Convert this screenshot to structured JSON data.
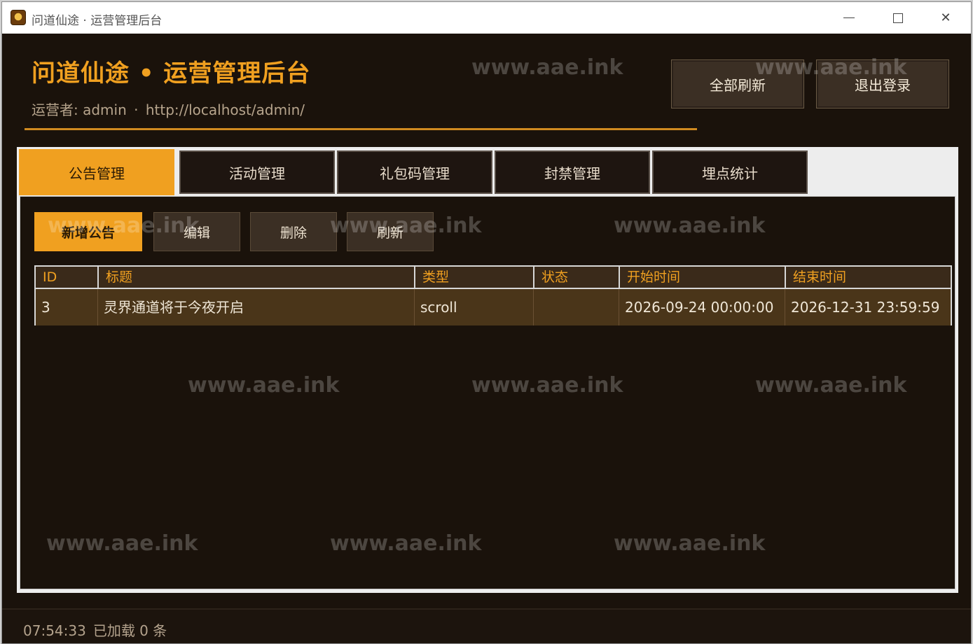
{
  "window": {
    "title": "问道仙途 · 运营管理后台",
    "min_icon": "minimize-icon",
    "max_icon": "maximize-icon",
    "close_icon": "close-icon"
  },
  "header": {
    "title": "问道仙途 • 运营管理后台",
    "operator_label": "运营者: admin",
    "separator": "·",
    "url": "http://localhost/admin/",
    "refresh_all_label": "全部刷新",
    "logout_label": "退出登录"
  },
  "tabs": [
    {
      "label": "公告管理",
      "active": true
    },
    {
      "label": "活动管理",
      "active": false
    },
    {
      "label": "礼包码管理",
      "active": false
    },
    {
      "label": "封禁管理",
      "active": false
    },
    {
      "label": "埋点统计",
      "active": false
    }
  ],
  "toolbar": {
    "add_label": "新增公告",
    "edit_label": "编辑",
    "delete_label": "删除",
    "refresh_label": "刷新"
  },
  "table": {
    "columns": [
      "ID",
      "标题",
      "类型",
      "状态",
      "开始时间",
      "结束时间"
    ],
    "rows": [
      [
        "3",
        "灵界通道将于今夜开启",
        "scroll",
        "",
        "2026-09-24 00:00:00",
        "2026-12-31 23:59:59"
      ]
    ]
  },
  "status": {
    "time": "07:54:33",
    "message": "已加载 0 条"
  },
  "watermark": "www.aae.ink",
  "colors": {
    "accent": "#f0a020",
    "background": "#1a120b",
    "button_bg": "#3b2f24",
    "row_bg": "#4a3519"
  }
}
